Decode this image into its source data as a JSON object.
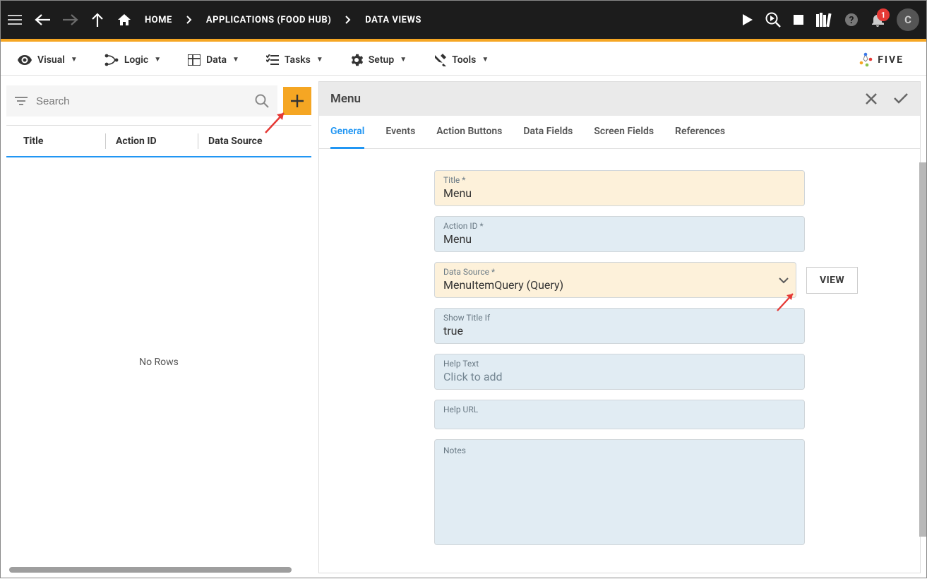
{
  "topbar": {
    "breadcrumb": {
      "home": "HOME",
      "app": "APPLICATIONS (FOOD HUB)",
      "page": "DATA VIEWS"
    },
    "avatar_initial": "C",
    "notification_badge": "1"
  },
  "menubar": {
    "visual": "Visual",
    "logic": "Logic",
    "data": "Data",
    "tasks": "Tasks",
    "setup": "Setup",
    "tools": "Tools",
    "logo": "FIVE"
  },
  "left_panel": {
    "search_placeholder": "Search",
    "columns": {
      "title": "Title",
      "action_id": "Action ID",
      "data_source": "Data Source"
    },
    "empty_text": "No Rows"
  },
  "right_panel": {
    "header": "Menu",
    "tabs": {
      "general": "General",
      "events": "Events",
      "action_buttons": "Action Buttons",
      "data_fields": "Data Fields",
      "screen_fields": "Screen Fields",
      "references": "References"
    },
    "form": {
      "title_label": "Title *",
      "title_value": "Menu",
      "action_id_label": "Action ID *",
      "action_id_value": "Menu",
      "data_source_label": "Data Source *",
      "data_source_value": "MenuItemQuery (Query)",
      "view_button": "VIEW",
      "show_title_if_label": "Show Title If",
      "show_title_if_value": "true",
      "help_text_label": "Help Text",
      "help_text_placeholder": "Click to add",
      "help_url_label": "Help URL",
      "notes_label": "Notes"
    }
  }
}
